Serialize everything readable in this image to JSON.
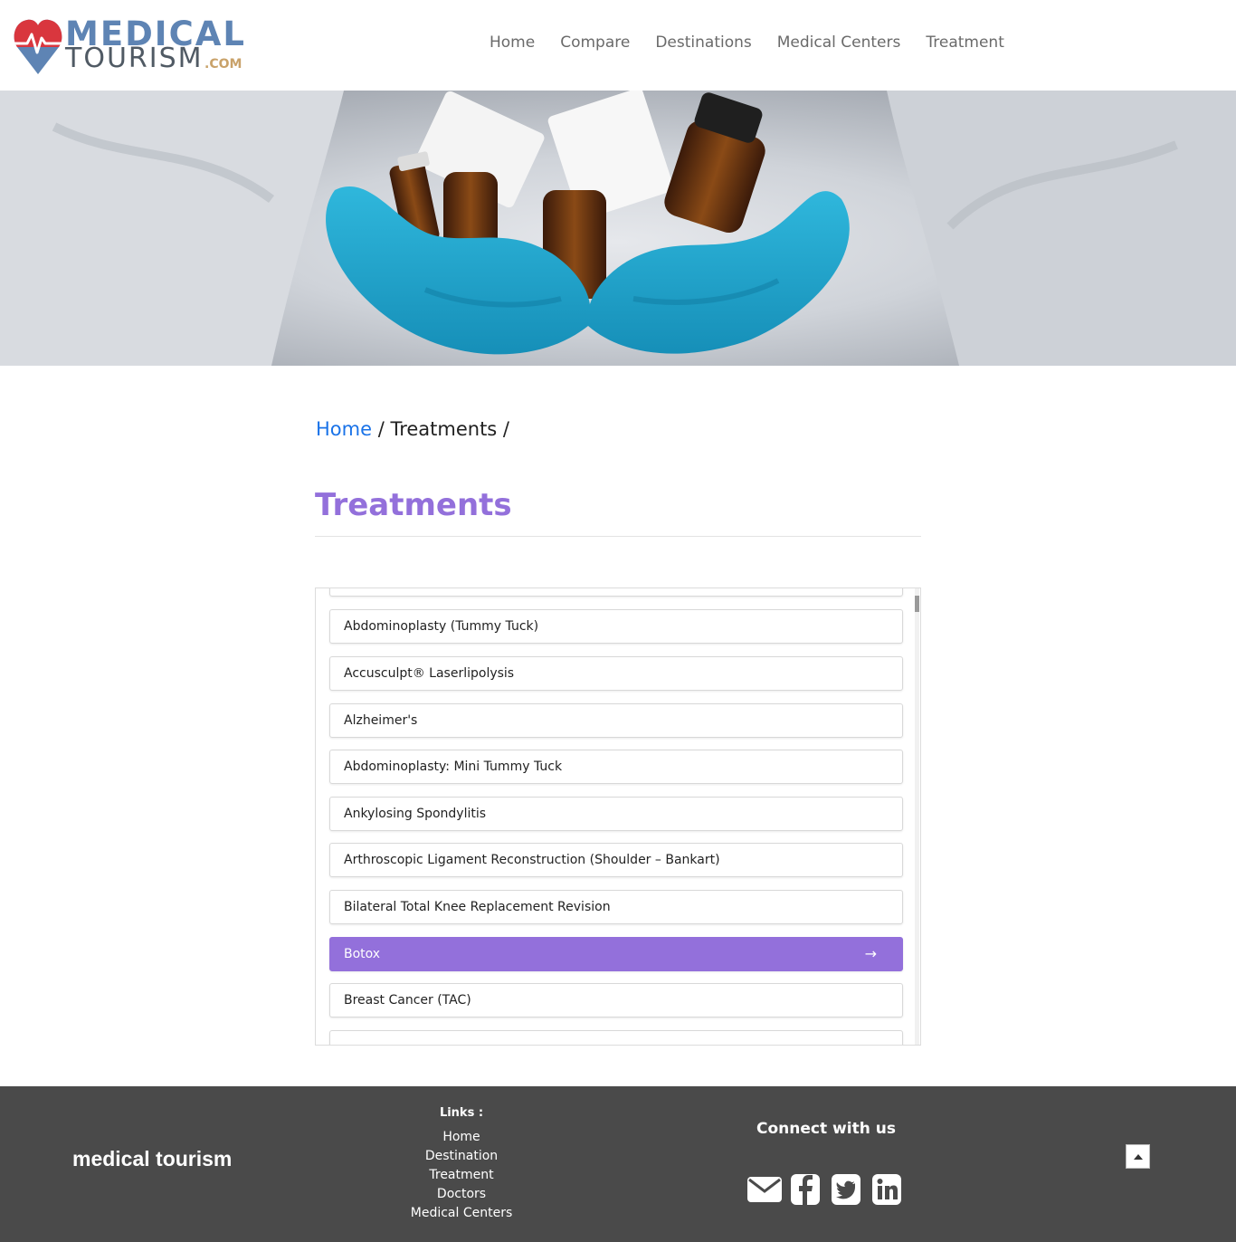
{
  "header": {
    "logo_line1": "MEDICAL",
    "logo_line2": "TOURISM",
    "logo_suffix": ".COM",
    "nav": [
      "Home",
      "Compare",
      "Destinations",
      "Medical Centers",
      "Treatment"
    ]
  },
  "breadcrumb": {
    "home": "Home",
    "sep1": " / ",
    "current": "Treatments",
    "sep2": " /"
  },
  "page_title": "Treatments",
  "treatments": {
    "items": [
      "Abdominoplasty (Tummy Tuck)",
      "Accusculpt® Laserlipolysis",
      "Alzheimer's",
      "Abdominoplasty: Mini Tummy Tuck",
      "Ankylosing Spondylitis",
      "Arthroscopic Ligament Reconstruction (Shoulder – Bankart)",
      "Bilateral Total Knee Replacement Revision",
      "Botox",
      "Breast Cancer (TAC)"
    ],
    "selected": "Botox",
    "selected_arrow": "→",
    "accent_color": "#9370db"
  },
  "footer": {
    "brand": "medical tourism",
    "links_title": "Links :",
    "links": [
      "Home",
      "Destination",
      "Treatment",
      "Doctors",
      "Medical Centers"
    ],
    "connect_title": "Connect with us",
    "social_icons": [
      "envelope-icon",
      "facebook-icon",
      "twitter-icon",
      "linkedin-icon"
    ]
  }
}
